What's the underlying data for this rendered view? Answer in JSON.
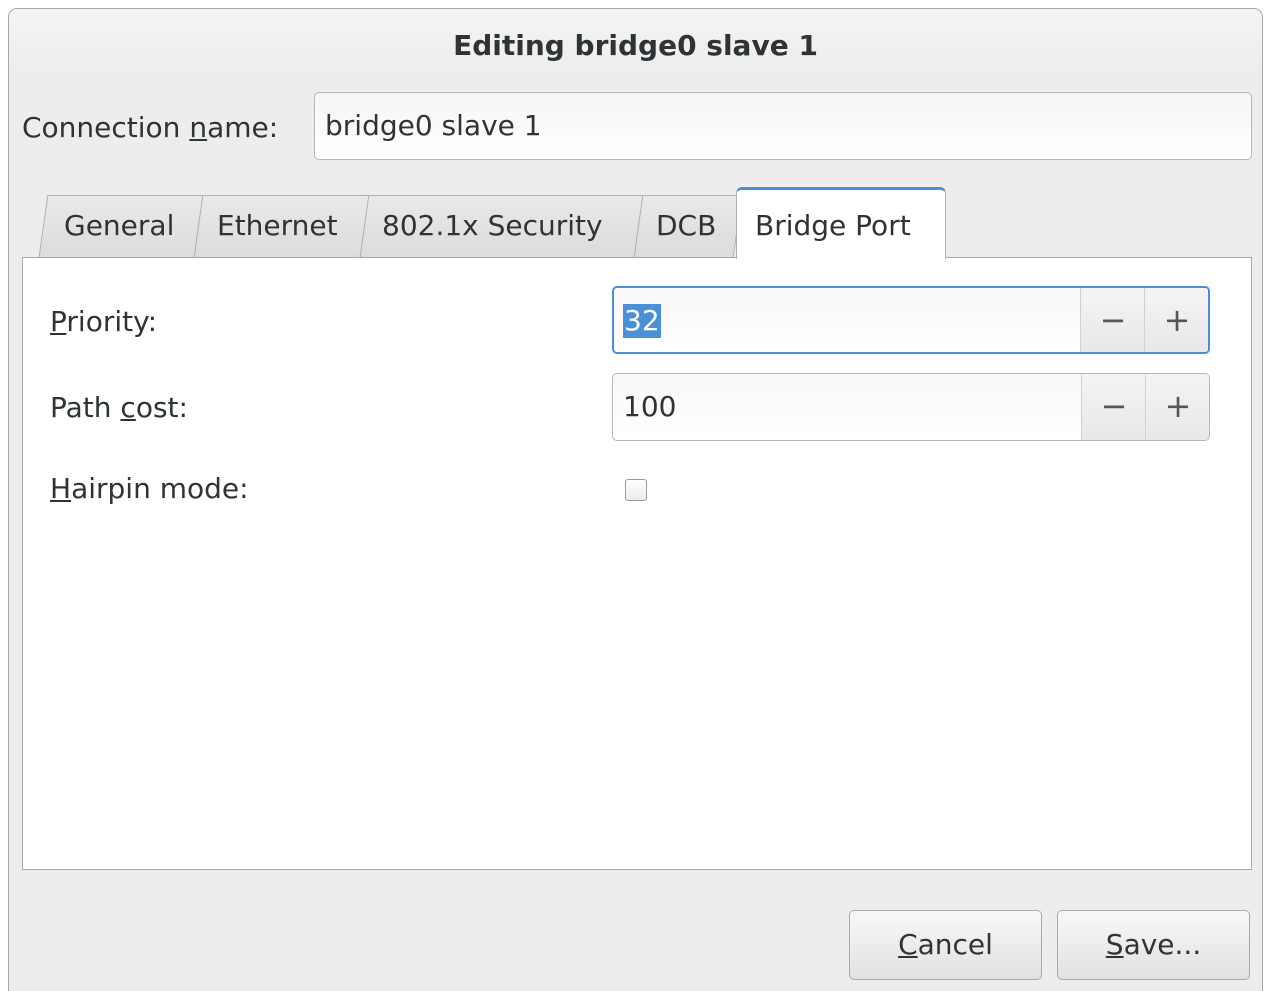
{
  "dialog": {
    "title": "Editing bridge0 slave 1"
  },
  "connection": {
    "label_pre": "Connection ",
    "label_mnemonic": "n",
    "label_post": "ame:",
    "value": "bridge0 slave 1"
  },
  "tabs": [
    {
      "label": "General"
    },
    {
      "label": "Ethernet"
    },
    {
      "label": "802.1x Security"
    },
    {
      "label": "DCB"
    },
    {
      "label": "Bridge Port"
    }
  ],
  "active_tab": "Bridge Port",
  "fields": {
    "priority": {
      "label_mnemonic": "P",
      "label_rest": "riority:",
      "value": "32"
    },
    "path_cost": {
      "label_pre": "Path ",
      "label_mnemonic": "c",
      "label_post": "ost:",
      "value": "100"
    },
    "hairpin": {
      "label_mnemonic": "H",
      "label_rest": "airpin mode:",
      "checked": false
    }
  },
  "spin_buttons": {
    "decrement": "−",
    "increment": "+"
  },
  "buttons": {
    "cancel": {
      "mnemonic": "C",
      "rest": "ancel"
    },
    "save": {
      "mnemonic": "S",
      "rest": "ave..."
    }
  },
  "colors": {
    "accent": "#4a90d9"
  }
}
